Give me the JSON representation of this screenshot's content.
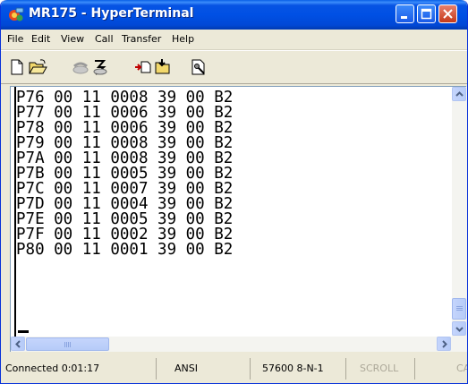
{
  "window": {
    "title": "MR175 - HyperTerminal",
    "app_icon": "hyperterminal-phone-icon"
  },
  "title_buttons": [
    "minimize",
    "maximize",
    "close"
  ],
  "menu": {
    "items": [
      "File",
      "Edit",
      "View",
      "Call",
      "Transfer",
      "Help"
    ]
  },
  "toolbar": {
    "tools": [
      {
        "icon": "new-document-icon"
      },
      {
        "icon": "open-folder-icon"
      },
      {
        "icon": "dial-phone-icon"
      },
      {
        "icon": "disconnect-icon"
      },
      {
        "icon": "send-file-icon"
      },
      {
        "icon": "receive-file-icon"
      },
      {
        "icon": "properties-icon"
      }
    ]
  },
  "terminal": {
    "lines": [
      "P76 00 11 0008 39 00 B2",
      "P77 00 11 0006 39 00 B2",
      "P78 00 11 0006 39 00 B2",
      "P79 00 11 0008 39 00 B2",
      "P7A 00 11 0008 39 00 B2",
      "P7B 00 11 0005 39 00 B2",
      "P7C 00 11 0007 39 00 B2",
      "P7D 00 11 0004 39 00 B2",
      "P7E 00 11 0005 39 00 B2",
      "P7F 00 11 0002 39 00 B2",
      "P80 00 11 0001 39 00 B2"
    ],
    "cursor": "_"
  },
  "status": {
    "connection": "Connected 0:01:17",
    "emulation": "ANSI",
    "port_settings": "57600 8-N-1",
    "scroll": "SCROLL",
    "caps": "CAPS"
  }
}
